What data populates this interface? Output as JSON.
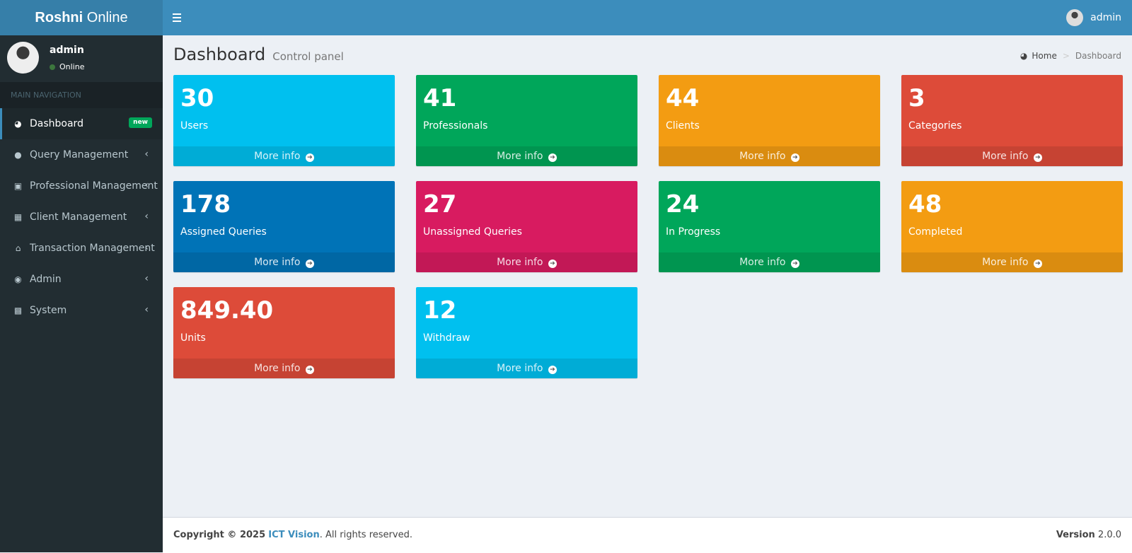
{
  "brand": {
    "bold": "Roshni",
    "rest": " Online"
  },
  "topbar": {
    "user": "admin"
  },
  "sidebar": {
    "user": {
      "name": "admin",
      "status": "Online"
    },
    "nav_header": "MAIN NAVIGATION",
    "items": [
      {
        "label": "Dashboard",
        "icon": "dashboard-icon",
        "badge": "new"
      },
      {
        "label": "Query Management",
        "icon": "comments-icon"
      },
      {
        "label": "Professional Management",
        "icon": "suitcase-icon"
      },
      {
        "label": "Client Management",
        "icon": "table-icon"
      },
      {
        "label": "Transaction Management",
        "icon": "bank-icon"
      },
      {
        "label": "Admin",
        "icon": "user-circle-icon"
      },
      {
        "label": "System",
        "icon": "gear-box-icon"
      }
    ]
  },
  "page": {
    "title": "Dashboard",
    "subtitle": "Control panel"
  },
  "breadcrumb": {
    "home": "Home",
    "current": "Dashboard"
  },
  "boxes": [
    {
      "value": "30",
      "label": "Users",
      "color": "#00c0ef",
      "more": "More info"
    },
    {
      "value": "41",
      "label": "Professionals",
      "color": "#00a65a",
      "more": "More info"
    },
    {
      "value": "44",
      "label": "Clients",
      "color": "#f39c12",
      "more": "More info"
    },
    {
      "value": "3",
      "label": "Categories",
      "color": "#dd4b39",
      "more": "More info"
    },
    {
      "value": "178",
      "label": "Assigned Queries",
      "color": "#0073b7",
      "more": "More info"
    },
    {
      "value": "27",
      "label": "Unassigned Queries",
      "color": "#d81b60",
      "more": "More info"
    },
    {
      "value": "24",
      "label": "In Progress",
      "color": "#00a65a",
      "more": "More info"
    },
    {
      "value": "48",
      "label": "Completed",
      "color": "#f39c12",
      "more": "More info"
    },
    {
      "value": "849.40",
      "label": "Units",
      "color": "#dd4b39",
      "more": "More info"
    },
    {
      "value": "12",
      "label": "Withdraw",
      "color": "#00c0ef",
      "more": "More info"
    }
  ],
  "footer": {
    "copyright": "Copyright © 2025",
    "company": "ICT Vision",
    "rights": ". All rights reserved.",
    "version_label": "Version",
    "version": "2.0.0"
  }
}
